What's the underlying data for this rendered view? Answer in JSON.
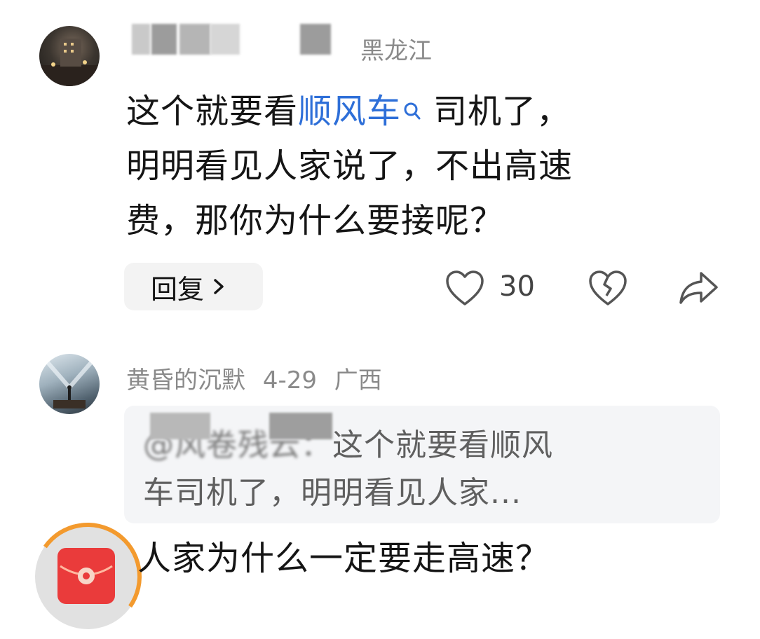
{
  "comment1": {
    "location": "黑龙江",
    "text_before_link": "这个就要看",
    "link_text": "顺风车",
    "text_line1_after": "司机了，",
    "text_line2": "明明看见人家说了，不出高速",
    "text_line3": "费，那你为什么要接呢？",
    "reply_label": "回复",
    "like_count": "30"
  },
  "comment2": {
    "username": "黄昏的沉默",
    "date": "4-29",
    "location": "广西",
    "quote_prefix": "@风卷残云：",
    "quote_line1": "这个就要看顺风",
    "quote_line2": "车司机了，明明看见人家...",
    "text": "人家为什么一定要走高速？"
  },
  "colors": {
    "link": "#2e6fd8",
    "ring": "#f39a2e",
    "red_packet": "#ea3b3b"
  },
  "icons": [
    "search-icon",
    "like-heart-icon",
    "dislike-broken-heart-icon",
    "share-icon",
    "chevron-right-icon",
    "red-packet-icon"
  ]
}
